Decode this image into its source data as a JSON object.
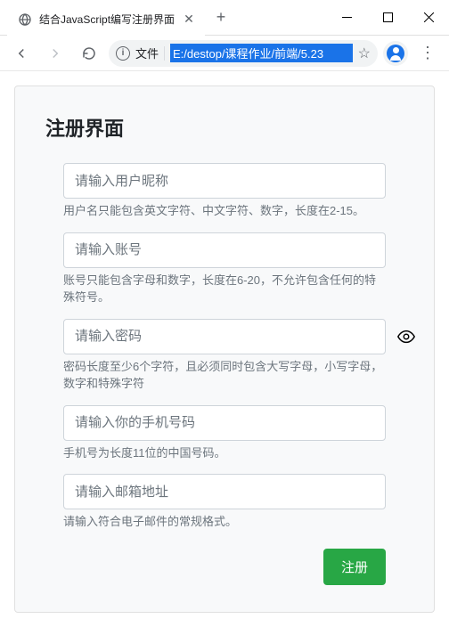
{
  "browser": {
    "tab_title": "结合JavaScript编写注册界面",
    "address_label": "文件",
    "address_url": "E:/destop/课程作业/前端/5.23"
  },
  "form": {
    "title": "注册界面",
    "fields": {
      "nickname": {
        "placeholder": "请输入用户昵称",
        "hint": "用户名只能包含英文字符、中文字符、数字，长度在2-15。"
      },
      "account": {
        "placeholder": "请输入账号",
        "hint": "账号只能包含字母和数字，长度在6-20，不允许包含任何的特殊符号。"
      },
      "password": {
        "placeholder": "请输入密码",
        "hint": "密码长度至少6个字符，且必须同时包含大写字母，小写字母，数字和特殊字符"
      },
      "phone": {
        "placeholder": "请输入你的手机号码",
        "hint": "手机号为长度11位的中国号码。"
      },
      "email": {
        "placeholder": "请输入邮箱地址",
        "hint": "请输入符合电子邮件的常规格式。"
      }
    },
    "submit_label": "注册"
  }
}
